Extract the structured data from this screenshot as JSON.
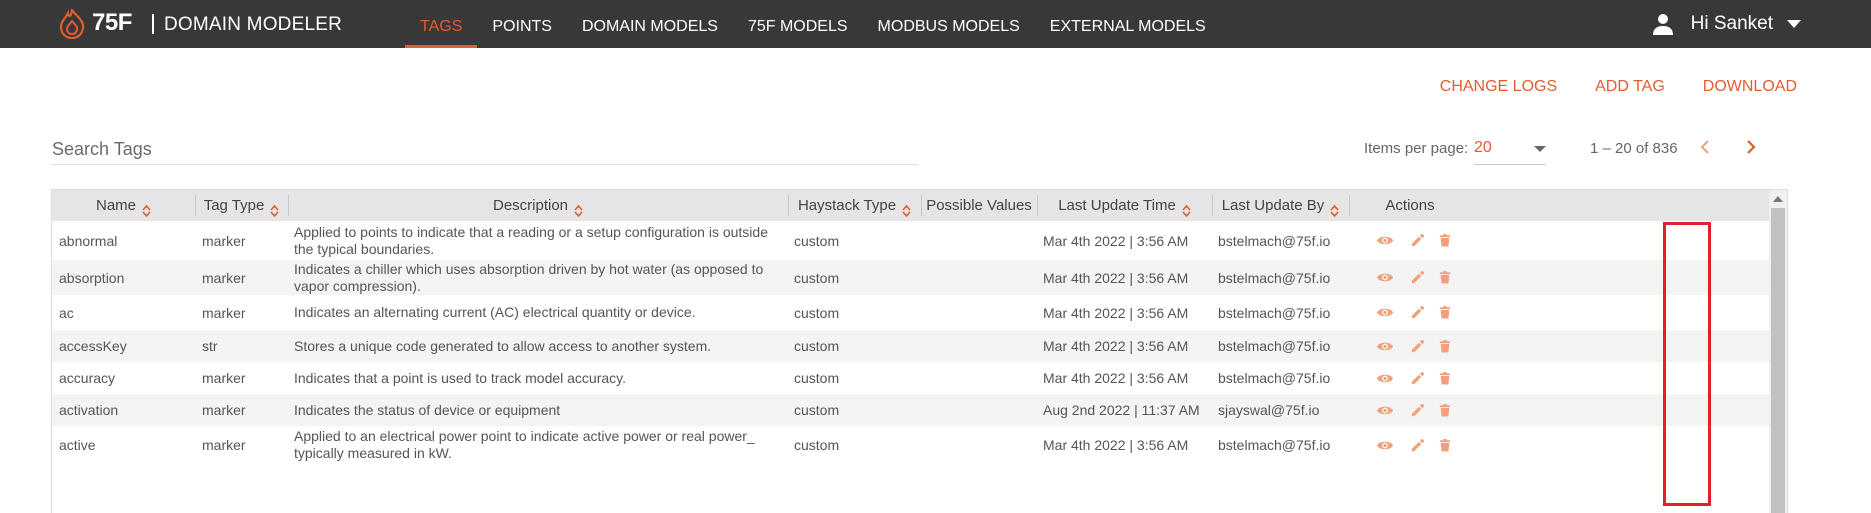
{
  "header": {
    "brand_number": "75F",
    "brand_name": "DOMAIN MODELER",
    "nav": [
      {
        "label": "TAGS",
        "active": true
      },
      {
        "label": "POINTS",
        "active": false
      },
      {
        "label": "DOMAIN MODELS",
        "active": false
      },
      {
        "label": "75F MODELS",
        "active": false
      },
      {
        "label": "MODBUS MODELS",
        "active": false
      },
      {
        "label": "EXTERNAL MODELS",
        "active": false
      }
    ],
    "user_greeting": "Hi Sanket",
    "icons": {
      "logo": "75f-flame-logo-icon",
      "user": "user-icon",
      "menu": "caret-down-icon"
    }
  },
  "actions": {
    "change_logs": "CHANGE LOGS",
    "add_tag": "ADD TAG",
    "download": "DOWNLOAD"
  },
  "search": {
    "placeholder": "Search Tags",
    "value": ""
  },
  "paginator": {
    "items_per_page_label": "Items per page:",
    "items_per_page": "20",
    "range": "1 – 20 of 836"
  },
  "table": {
    "columns": [
      "Name",
      "Tag Type",
      "Description",
      "Haystack Type",
      "Possible Values",
      "Last Update Time",
      "Last Update By",
      "Actions"
    ],
    "sortable": [
      true,
      true,
      true,
      true,
      false,
      true,
      true,
      false
    ],
    "row_actions": [
      "view-eye-icon",
      "edit-pencil-icon",
      "delete-trash-icon"
    ],
    "rows": [
      {
        "name": "abnormal",
        "tag_type": "marker",
        "description": "Applied to points to indicate that a reading or a setup configuration is outside the typical boundaries.",
        "haystack_type": "custom",
        "possible_values": "",
        "last_update_time": "Mar 4th 2022 | 3:56 AM",
        "last_update_by": "bstelmach@75f.io"
      },
      {
        "name": "absorption",
        "tag_type": "marker",
        "description": "Indicates a chiller which uses absorption driven by hot water (as opposed to vapor compression).",
        "haystack_type": "custom",
        "possible_values": "",
        "last_update_time": "Mar 4th 2022 | 3:56 AM",
        "last_update_by": "bstelmach@75f.io"
      },
      {
        "name": "ac",
        "tag_type": "marker",
        "description": "Indicates an alternating current (AC) electrical quantity or device.",
        "haystack_type": "custom",
        "possible_values": "",
        "last_update_time": "Mar 4th 2022 | 3:56 AM",
        "last_update_by": "bstelmach@75f.io"
      },
      {
        "name": "accessKey",
        "tag_type": "str",
        "description": "Stores a unique code generated to allow access to another system.",
        "haystack_type": "custom",
        "possible_values": "",
        "last_update_time": "Mar 4th 2022 | 3:56 AM",
        "last_update_by": "bstelmach@75f.io"
      },
      {
        "name": "accuracy",
        "tag_type": "marker",
        "description": "Indicates that a point is used to track model accuracy.",
        "haystack_type": "custom",
        "possible_values": "",
        "last_update_time": "Mar 4th 2022 | 3:56 AM",
        "last_update_by": "bstelmach@75f.io"
      },
      {
        "name": "activation",
        "tag_type": "marker",
        "description": "Indicates the status of device or equipment",
        "haystack_type": "custom",
        "possible_values": "",
        "last_update_time": "Aug 2nd 2022 | 11:37 AM",
        "last_update_by": "sjayswal@75f.io"
      },
      {
        "name": "active",
        "tag_type": "marker",
        "description": "Applied to an electrical power point to indicate active power or real power_ typically measured in kW.",
        "haystack_type": "custom",
        "possible_values": "",
        "last_update_time": "Mar 4th 2022 | 3:56 AM",
        "last_update_by": "bstelmach@75f.io"
      }
    ]
  },
  "colors": {
    "accent": "#e35c2e",
    "topbar": "#383838",
    "header_row": "#e5e5e5",
    "icon": "#f0a07d",
    "highlight": "#e0202d"
  }
}
